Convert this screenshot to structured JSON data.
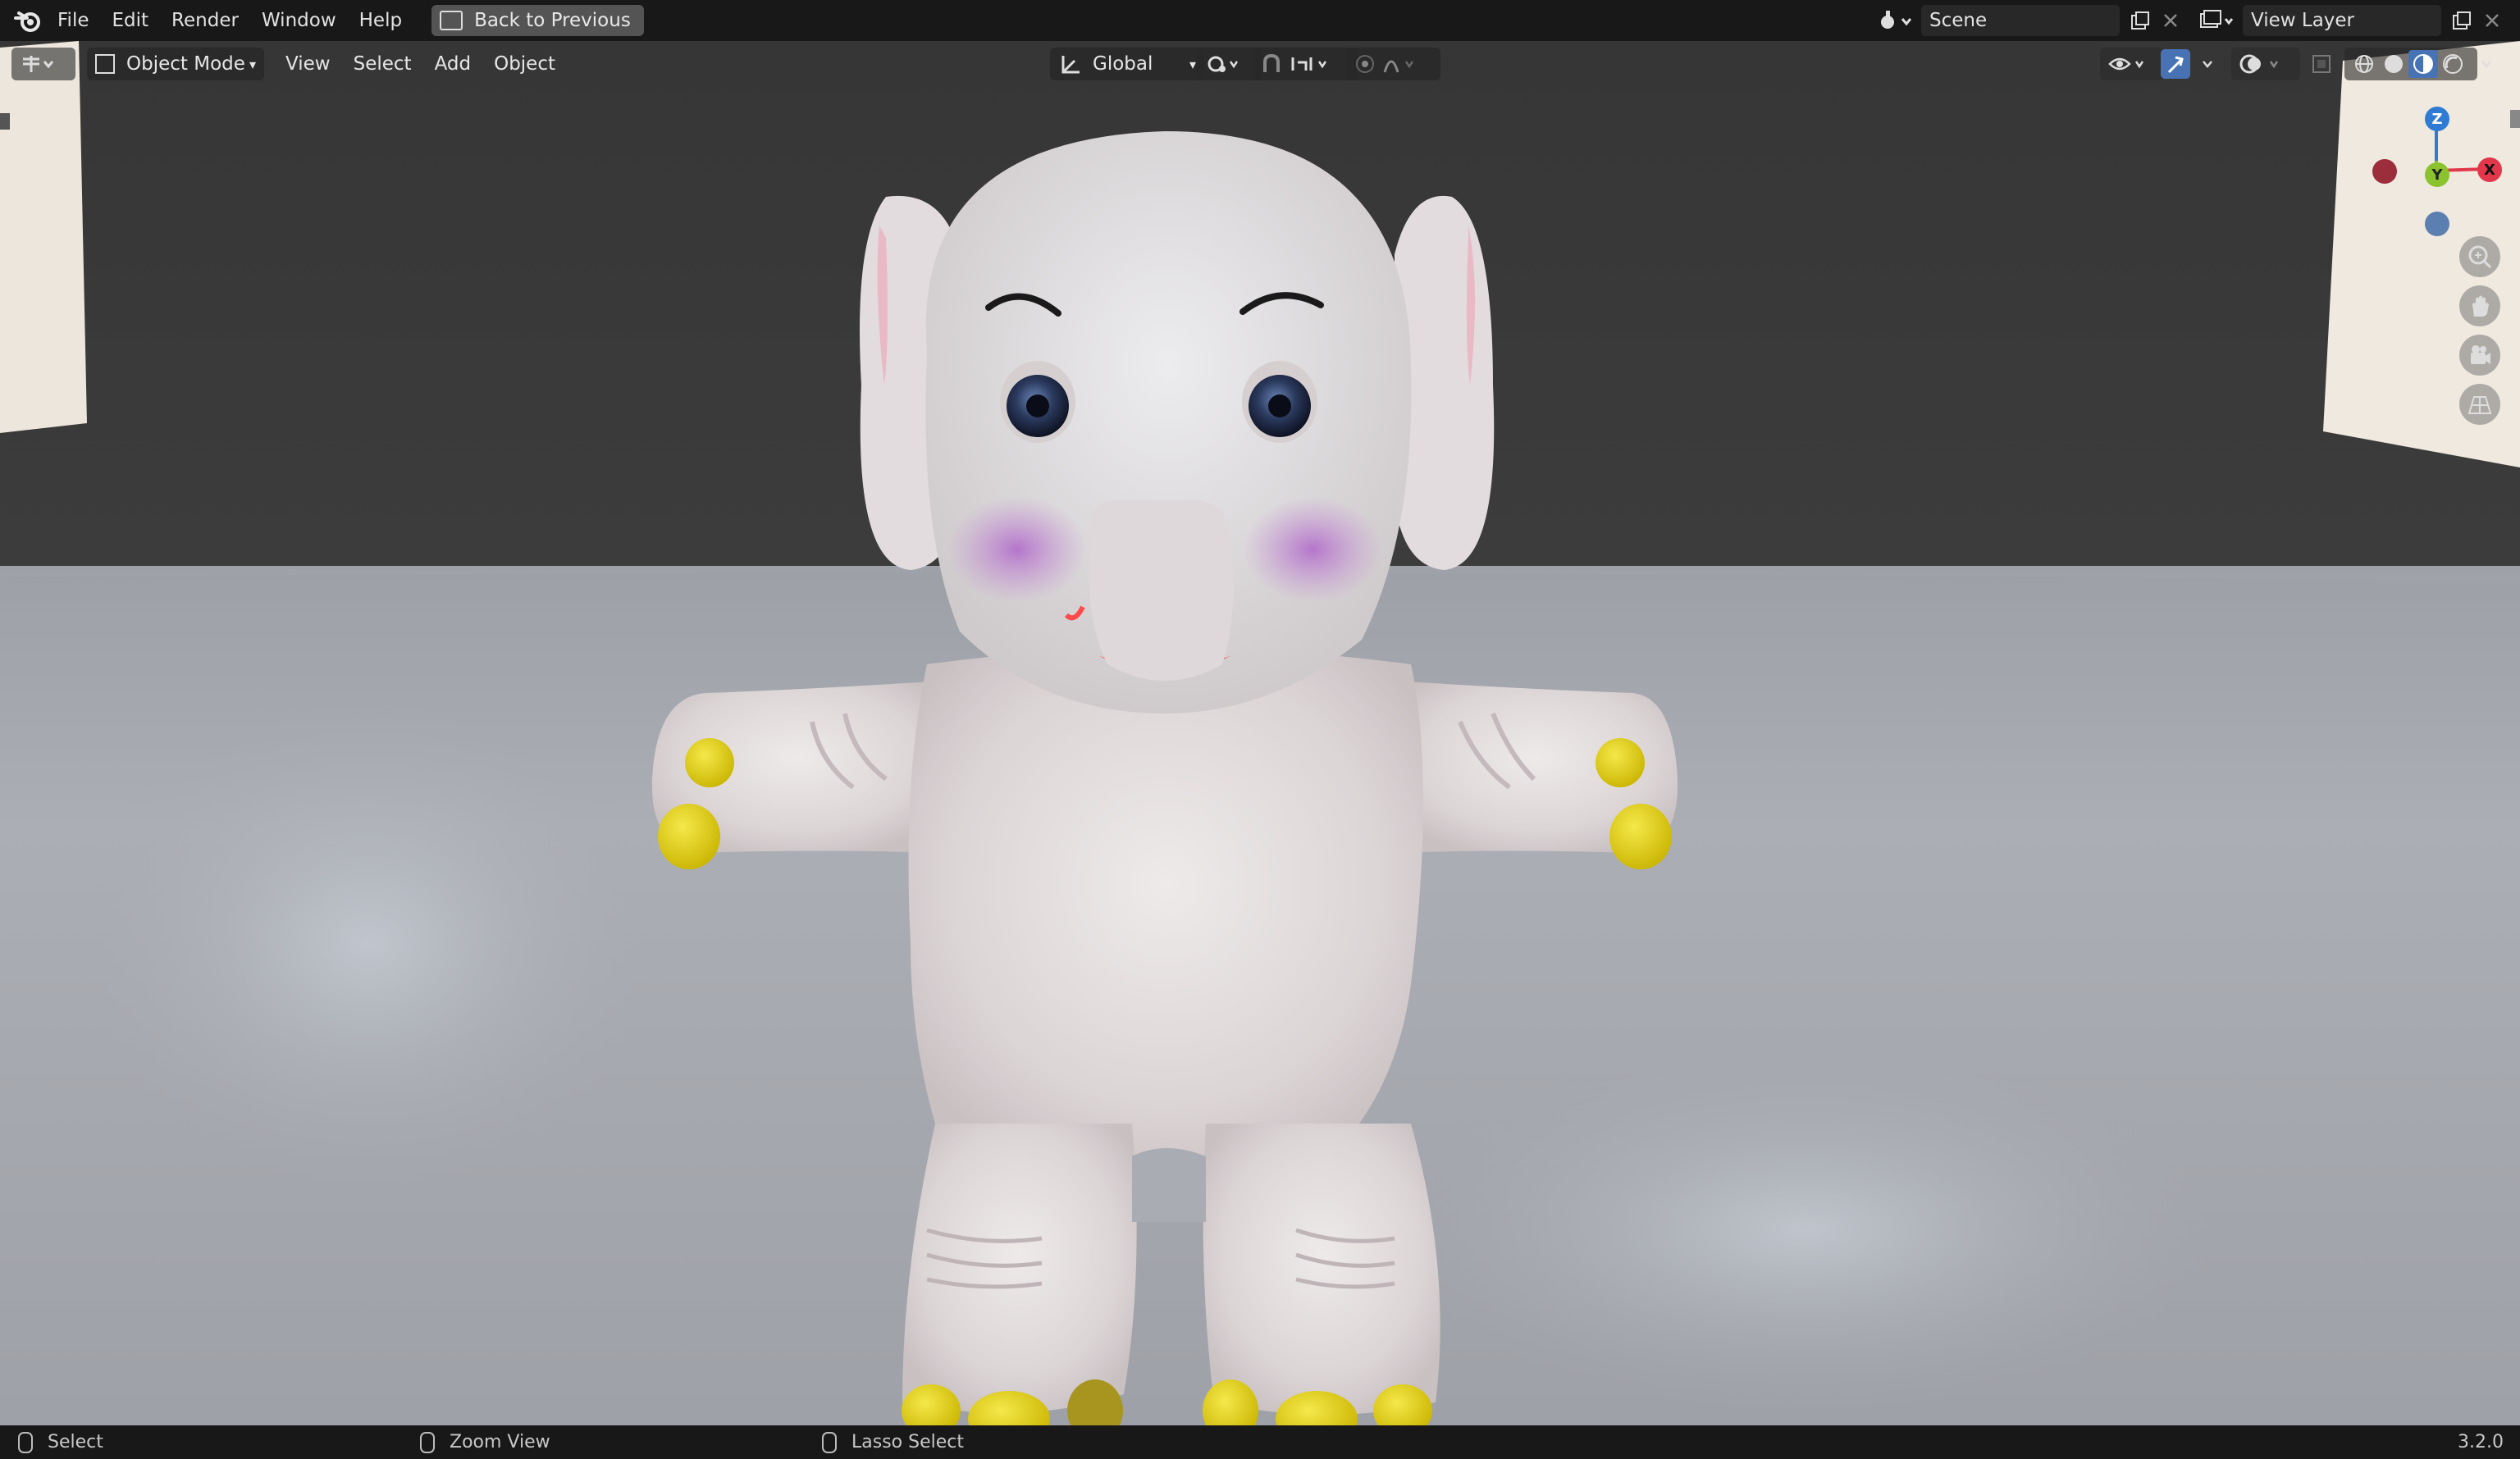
{
  "menu": {
    "items": [
      "File",
      "Edit",
      "Render",
      "Window",
      "Help"
    ],
    "back_button": "Back to Previous"
  },
  "scene": {
    "name": "Scene"
  },
  "view_layer": {
    "name": "View Layer"
  },
  "viewport_header": {
    "mode": "Object Mode",
    "items": [
      "View",
      "Select",
      "Add",
      "Object"
    ],
    "transform_orientation": "Global"
  },
  "gizmo": {
    "z": "Z",
    "y": "Y",
    "x": "X"
  },
  "status": {
    "select": "Select",
    "zoom": "Zoom View",
    "lasso": "Lasso Select",
    "version": "3.2.0"
  },
  "colors": {
    "topbar": "#181818",
    "active_icon": "#4772b3",
    "x_axis": "#e2374a",
    "y_axis": "#8bc32f",
    "z_axis": "#2f7bd4"
  }
}
